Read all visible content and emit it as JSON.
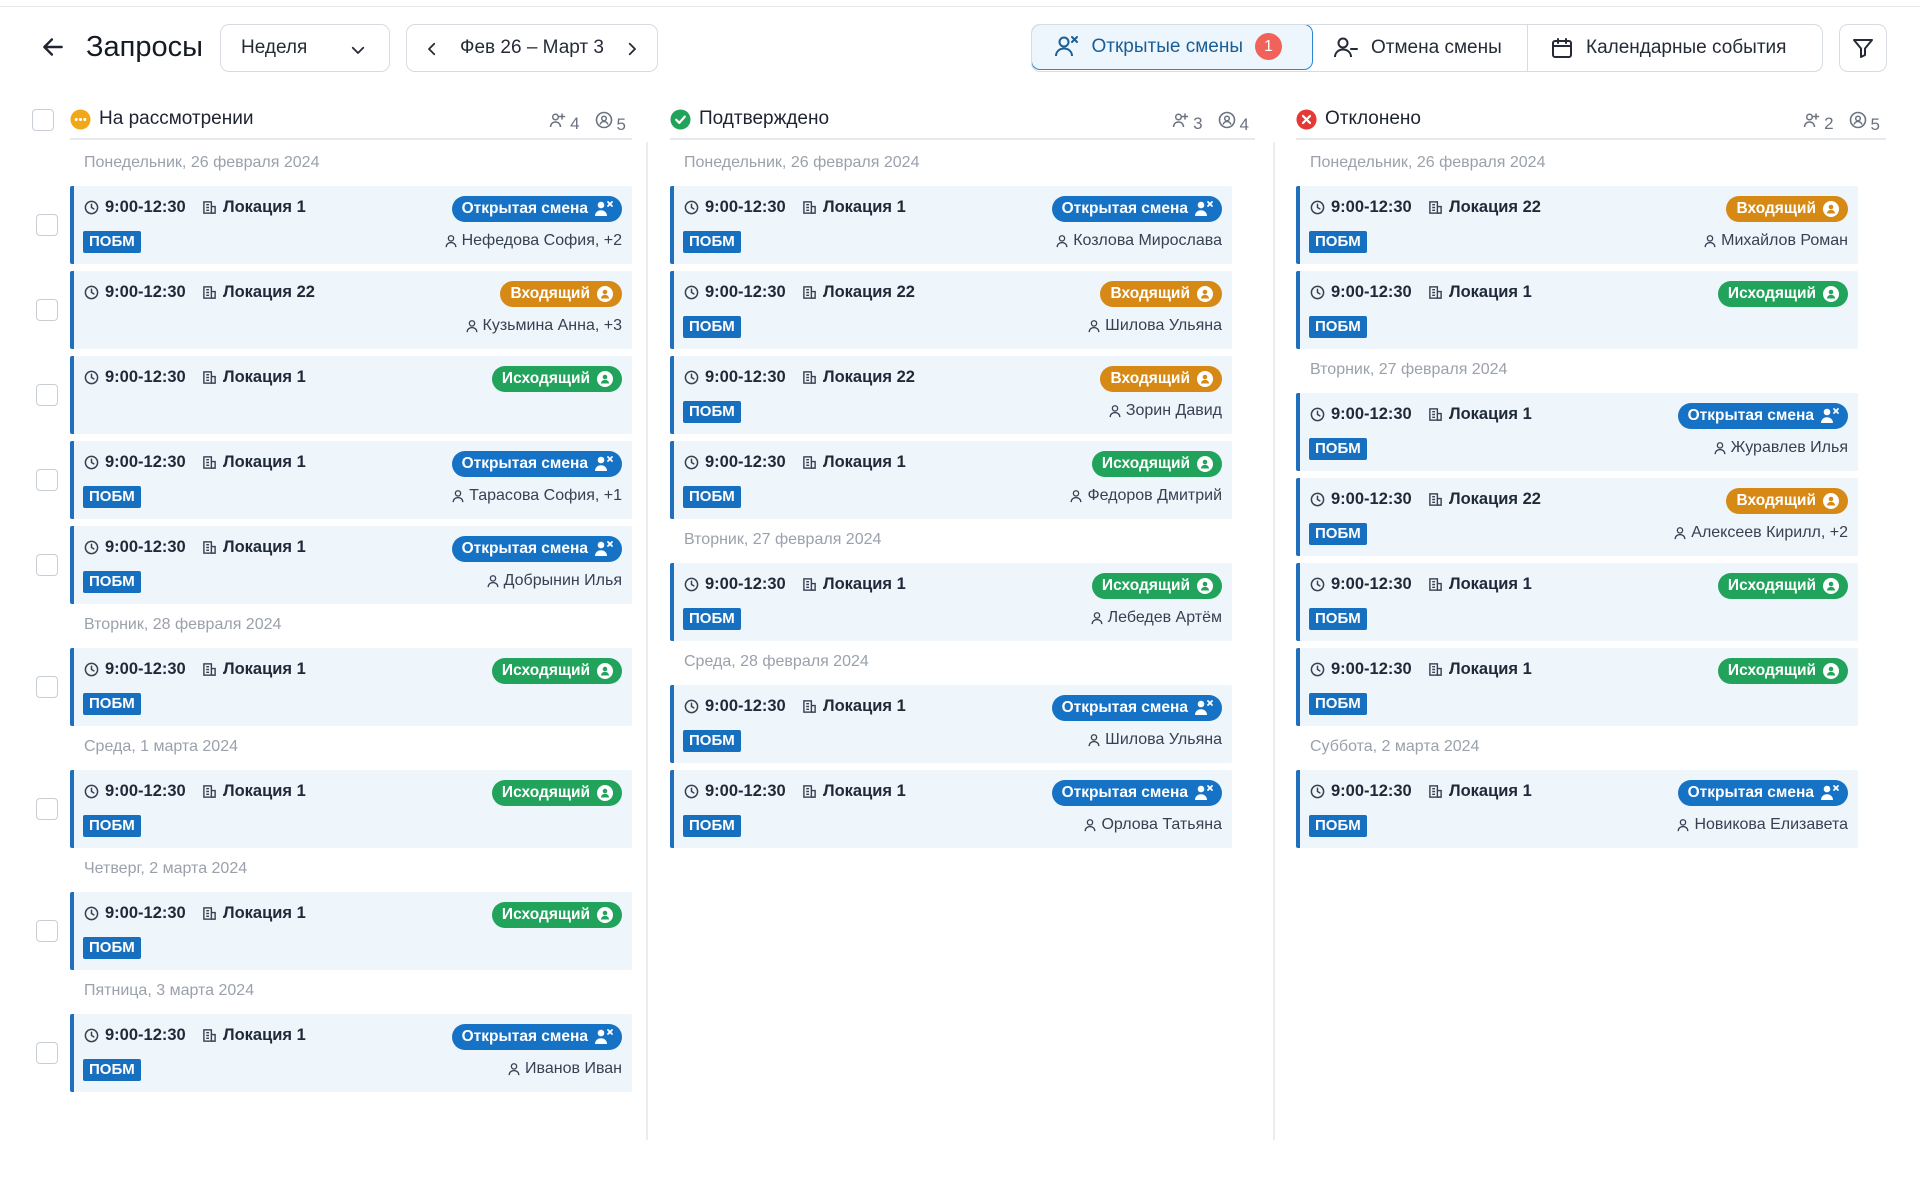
{
  "header": {
    "title": "Запросы",
    "period": "Неделя",
    "range": "Фев 26 – Март 3",
    "tabs": [
      {
        "label": "Открытые смены",
        "badge": "1"
      },
      {
        "label": "Отмена смены"
      },
      {
        "label": "Календарные события"
      }
    ]
  },
  "colors": {
    "open": "#1672c5",
    "incoming": "#d68a15",
    "outgoing": "#22a35c",
    "pending": "#f0a818",
    "approved": "#22a35c",
    "rejected": "#e53935"
  },
  "columns": [
    {
      "title": "На рассмотрении",
      "status": "pending",
      "people": "4",
      "shifts": "5",
      "groups": [
        {
          "date": "Понедельник, 26 февраля 2024",
          "cards": [
            {
              "time": "9:00-12:30",
              "location": "Локация 1",
              "tag": "ПОБМ",
              "pill": "Открытая смена",
              "type": "open",
              "person": "Нефедова София, +2"
            },
            {
              "time": "9:00-12:30",
              "location": "Локация 22",
              "tag": "",
              "pill": "Входящий",
              "type": "in",
              "person": "Кузьмина Анна, +3"
            },
            {
              "time": "9:00-12:30",
              "location": "Локация 1",
              "tag": "",
              "pill": "Исходящий",
              "type": "out",
              "person": ""
            },
            {
              "time": "9:00-12:30",
              "location": "Локация 1",
              "tag": "ПОБМ",
              "pill": "Открытая смена",
              "type": "open",
              "person": "Тарасова София, +1"
            },
            {
              "time": "9:00-12:30",
              "location": "Локация 1",
              "tag": "ПОБМ",
              "pill": "Открытая смена",
              "type": "open",
              "person": "Добрынин Илья"
            }
          ]
        },
        {
          "date": "Вторник, 28 февраля 2024",
          "cards": [
            {
              "time": "9:00-12:30",
              "location": "Локация 1",
              "tag": "ПОБМ",
              "pill": "Исходящий",
              "type": "out",
              "person": ""
            }
          ]
        },
        {
          "date": "Среда, 1 марта 2024",
          "cards": [
            {
              "time": "9:00-12:30",
              "location": "Локация 1",
              "tag": "ПОБМ",
              "pill": "Исходящий",
              "type": "out",
              "person": ""
            }
          ]
        },
        {
          "date": "Четверг, 2 марта 2024",
          "cards": [
            {
              "time": "9:00-12:30",
              "location": "Локация 1",
              "tag": "ПОБМ",
              "pill": "Исходящий",
              "type": "out",
              "person": ""
            }
          ]
        },
        {
          "date": "Пятница, 3 марта 2024",
          "cards": [
            {
              "time": "9:00-12:30",
              "location": "Локация 1",
              "tag": "ПОБМ",
              "pill": "Открытая смена",
              "type": "open",
              "person": "Иванов Иван"
            }
          ]
        }
      ]
    },
    {
      "title": "Подтверждено",
      "status": "approved",
      "people": "3",
      "shifts": "4",
      "groups": [
        {
          "date": "Понедельник, 26 февраля 2024",
          "cards": [
            {
              "time": "9:00-12:30",
              "location": "Локация 1",
              "tag": "ПОБМ",
              "pill": "Открытая смена",
              "type": "open",
              "person": "Козлова Мирослава"
            },
            {
              "time": "9:00-12:30",
              "location": "Локация 22",
              "tag": "ПОБМ",
              "pill": "Входящий",
              "type": "in",
              "person": "Шилова Ульяна"
            },
            {
              "time": "9:00-12:30",
              "location": "Локация 22",
              "tag": "ПОБМ",
              "pill": "Входящий",
              "type": "in",
              "person": "Зорин Давид"
            },
            {
              "time": "9:00-12:30",
              "location": "Локация 1",
              "tag": "ПОБМ",
              "pill": "Исходящий",
              "type": "out",
              "person": "Федоров Дмитрий"
            }
          ]
        },
        {
          "date": "Вторник, 27 февраля 2024",
          "cards": [
            {
              "time": "9:00-12:30",
              "location": "Локация 1",
              "tag": "ПОБМ",
              "pill": "Исходящий",
              "type": "out",
              "person": "Лебедев Артём"
            }
          ]
        },
        {
          "date": "Среда, 28 февраля 2024",
          "cards": [
            {
              "time": "9:00-12:30",
              "location": "Локация 1",
              "tag": "ПОБМ",
              "pill": "Открытая смена",
              "type": "open",
              "person": "Шилова Ульяна"
            },
            {
              "time": "9:00-12:30",
              "location": "Локация 1",
              "tag": "ПОБМ",
              "pill": "Открытая смена",
              "type": "open",
              "person": "Орлова Татьяна"
            }
          ]
        }
      ]
    },
    {
      "title": "Отклонено",
      "status": "rejected",
      "people": "2",
      "shifts": "5",
      "groups": [
        {
          "date": "Понедельник, 26 февраля 2024",
          "cards": [
            {
              "time": "9:00-12:30",
              "location": "Локация 22",
              "tag": "ПОБМ",
              "pill": "Входящий",
              "type": "in",
              "person": "Михайлов Роман"
            },
            {
              "time": "9:00-12:30",
              "location": "Локация 1",
              "tag": "ПОБМ",
              "pill": "Исходящий",
              "type": "out",
              "person": ""
            }
          ]
        },
        {
          "date": "Вторник, 27 февраля 2024",
          "cards": [
            {
              "time": "9:00-12:30",
              "location": "Локация 1",
              "tag": "ПОБМ",
              "pill": "Открытая смена",
              "type": "open",
              "person": "Журавлев Илья"
            },
            {
              "time": "9:00-12:30",
              "location": "Локация 22",
              "tag": "ПОБМ",
              "pill": "Входящий",
              "type": "in",
              "person": "Алексеев Кирилл, +2"
            },
            {
              "time": "9:00-12:30",
              "location": "Локация 1",
              "tag": "ПОБМ",
              "pill": "Исходящий",
              "type": "out",
              "person": ""
            },
            {
              "time": "9:00-12:30",
              "location": "Локация 1",
              "tag": "ПОБМ",
              "pill": "Исходящий",
              "type": "out",
              "person": ""
            }
          ]
        },
        {
          "date": "Суббота, 2 марта 2024",
          "cards": [
            {
              "time": "9:00-12:30",
              "location": "Локация 1",
              "tag": "ПОБМ",
              "pill": "Открытая смена",
              "type": "open",
              "person": "Новикова Елизавета"
            }
          ]
        }
      ]
    }
  ]
}
